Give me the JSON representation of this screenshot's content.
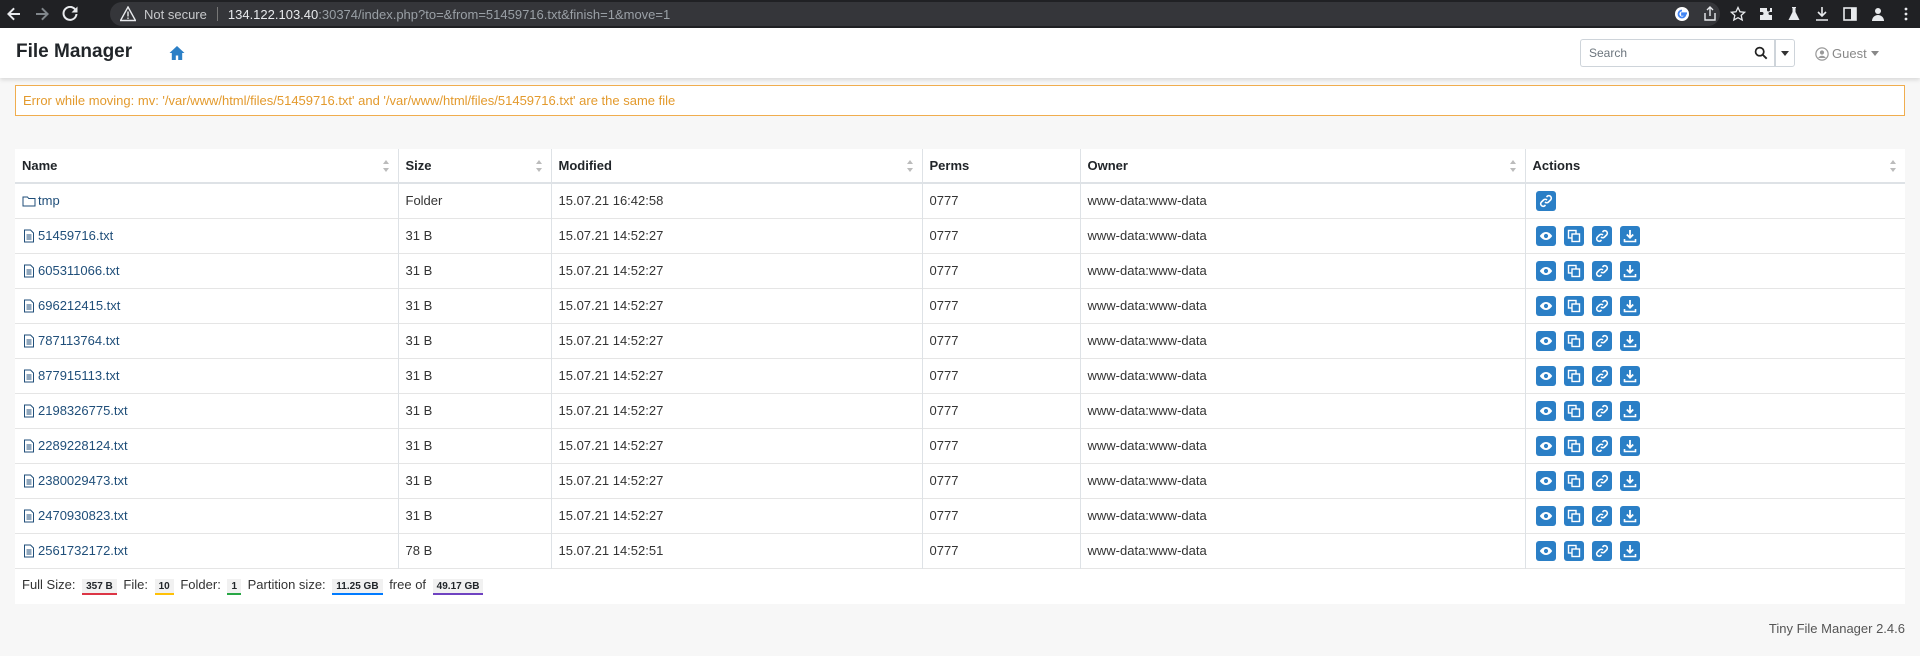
{
  "browser": {
    "not_secure_label": "Not secure",
    "url_host": "134.122.103.40",
    "url_rest": ":30374/index.php?to=&from=51459716.txt&finish=1&move=1"
  },
  "app": {
    "title": "File Manager",
    "search_placeholder": "Search",
    "user_label": "Guest"
  },
  "alert": {
    "message": "Error while moving: mv: '/var/www/html/files/51459716.txt' and '/var/www/html/files/51459716.txt' are the same file"
  },
  "table": {
    "columns": [
      "Name",
      "Size",
      "Modified",
      "Perms",
      "Owner",
      "Actions"
    ],
    "rows": [
      {
        "name": "tmp",
        "size": "Folder",
        "modified": "15.07.21 16:42:58",
        "perms": "0777",
        "owner": "www-data:www-data"
      },
      {
        "name": "51459716.txt",
        "size": "31 B",
        "modified": "15.07.21 14:52:27",
        "perms": "0777",
        "owner": "www-data:www-data"
      },
      {
        "name": "605311066.txt",
        "size": "31 B",
        "modified": "15.07.21 14:52:27",
        "perms": "0777",
        "owner": "www-data:www-data"
      },
      {
        "name": "696212415.txt",
        "size": "31 B",
        "modified": "15.07.21 14:52:27",
        "perms": "0777",
        "owner": "www-data:www-data"
      },
      {
        "name": "787113764.txt",
        "size": "31 B",
        "modified": "15.07.21 14:52:27",
        "perms": "0777",
        "owner": "www-data:www-data"
      },
      {
        "name": "877915113.txt",
        "size": "31 B",
        "modified": "15.07.21 14:52:27",
        "perms": "0777",
        "owner": "www-data:www-data"
      },
      {
        "name": "2198326775.txt",
        "size": "31 B",
        "modified": "15.07.21 14:52:27",
        "perms": "0777",
        "owner": "www-data:www-data"
      },
      {
        "name": "2289228124.txt",
        "size": "31 B",
        "modified": "15.07.21 14:52:27",
        "perms": "0777",
        "owner": "www-data:www-data"
      },
      {
        "name": "2380029473.txt",
        "size": "31 B",
        "modified": "15.07.21 14:52:27",
        "perms": "0777",
        "owner": "www-data:www-data"
      },
      {
        "name": "2470930823.txt",
        "size": "31 B",
        "modified": "15.07.21 14:52:27",
        "perms": "0777",
        "owner": "www-data:www-data"
      },
      {
        "name": "2561732172.txt",
        "size": "78 B",
        "modified": "15.07.21 14:52:51",
        "perms": "0777",
        "owner": "www-data:www-data"
      }
    ]
  },
  "footer": {
    "full_size_label": "Full Size:",
    "full_size": "357 B",
    "file_label": "File:",
    "file_count": "10",
    "folder_label": "Folder:",
    "folder_count": "1",
    "partition_label": "Partition size:",
    "partition_size": "11.25 GB",
    "free_of_label": "free of",
    "total_size": "49.17 GB"
  },
  "colors": {
    "accent": "#2b7fc6",
    "alert_border": "#f0ad4e",
    "badge_full": "#dc3545",
    "badge_file": "#ffc107",
    "badge_folder": "#28a745",
    "badge_partition": "#007bff",
    "badge_total": "#6f42c1"
  },
  "version": "Tiny File Manager 2.4.6"
}
